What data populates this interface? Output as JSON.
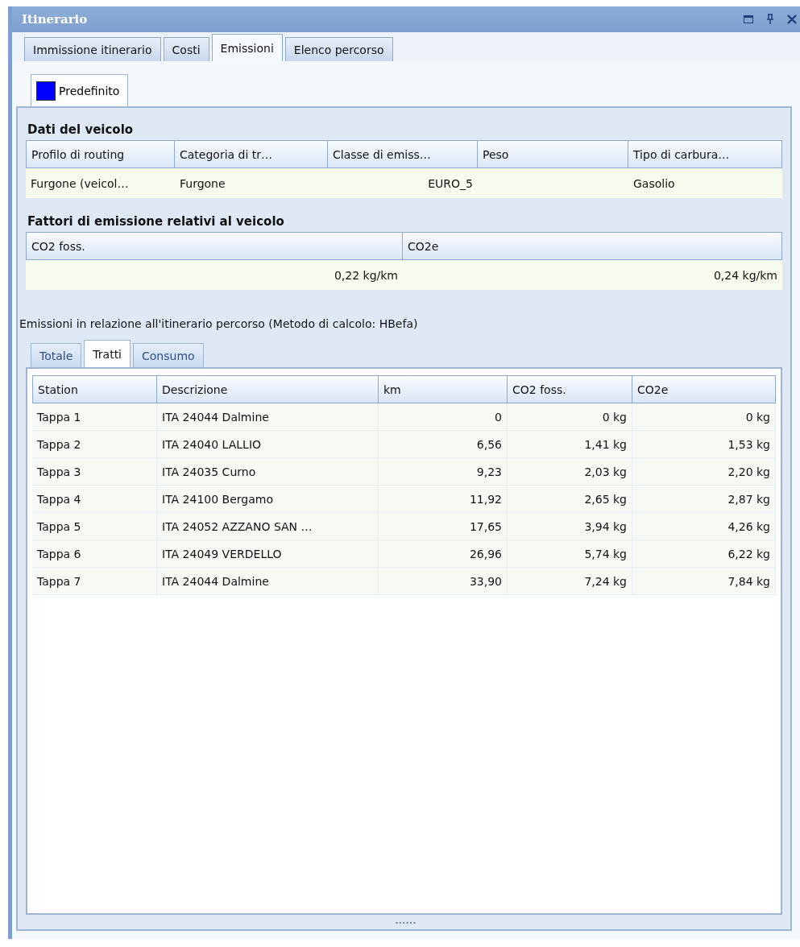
{
  "window": {
    "title": "Itinerario"
  },
  "tabs": [
    {
      "label": "Immissione itinerario",
      "selected": false
    },
    {
      "label": "Costi",
      "selected": false
    },
    {
      "label": "Emissioni",
      "selected": true
    },
    {
      "label": "Elenco percorso",
      "selected": false
    }
  ],
  "profile_tab": {
    "label": "Predefinito",
    "color": "#0000ff"
  },
  "vehicle_data": {
    "title": "Dati del veicolo",
    "columns": [
      "Profilo di routing",
      "Categoria di tr…",
      "Classe di emiss…",
      "Peso",
      "Tipo di carbura…"
    ],
    "rows": [
      [
        "Furgone (veicol…",
        "Furgone",
        "EURO_5",
        "",
        "Gasolio"
      ]
    ]
  },
  "emission_factors": {
    "title": "Fattori di emissione relativi al veicolo",
    "columns": [
      "CO2 foss.",
      "CO2e"
    ],
    "rows": [
      [
        "0,22 kg/km",
        "0,24 kg/km"
      ]
    ]
  },
  "route_emissions": {
    "title": "Emissioni in relazione all'itinerario percorso (Metodo di calcolo: HBefa)",
    "tabs": [
      {
        "label": "Totale",
        "selected": false
      },
      {
        "label": "Tratti",
        "selected": true
      },
      {
        "label": "Consumo",
        "selected": false
      }
    ],
    "columns": [
      "Station",
      "Descrizione",
      "km",
      "CO2 foss.",
      "CO2e"
    ],
    "rows": [
      [
        "Tappa 1",
        "ITA 24044 Dalmine",
        "0",
        "0 kg",
        "0 kg"
      ],
      [
        "Tappa 2",
        "ITA 24040 LALLIO",
        "6,56",
        "1,41 kg",
        "1,53 kg"
      ],
      [
        "Tappa 3",
        "ITA 24035 Curno",
        "9,23",
        "2,03 kg",
        "2,20 kg"
      ],
      [
        "Tappa 4",
        "ITA 24100 Bergamo",
        "11,92",
        "2,65 kg",
        "2,87 kg"
      ],
      [
        "Tappa 5",
        "ITA 24052 AZZANO SAN …",
        "17,65",
        "3,94 kg",
        "4,26 kg"
      ],
      [
        "Tappa 6",
        "ITA 24049 VERDELLO",
        "26,96",
        "5,74 kg",
        "6,22 kg"
      ],
      [
        "Tappa 7",
        "ITA 24044 Dalmine",
        "33,90",
        "7,24 kg",
        "7,84 kg"
      ]
    ]
  }
}
